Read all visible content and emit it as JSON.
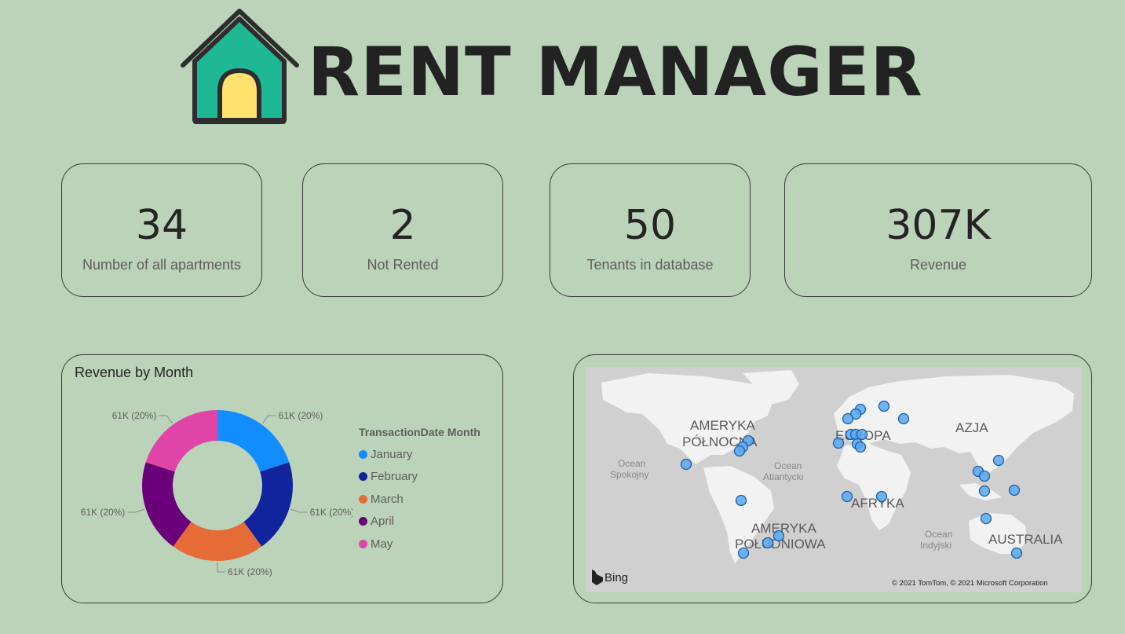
{
  "header": {
    "title": "RENT MANAGER",
    "logo_icon": "house-icon"
  },
  "kpis": [
    {
      "value": "34",
      "label": "Number of all apartments"
    },
    {
      "value": "2",
      "label": "Not Rented"
    },
    {
      "value": "50",
      "label": "Tenants in database"
    },
    {
      "value": "307K",
      "label": "Revenue"
    }
  ],
  "chart_data": {
    "type": "pie",
    "title": "Revenue by Month",
    "legend_title": "TransactionDate Month",
    "legend_position": "right",
    "categories": [
      "January",
      "February",
      "March",
      "April",
      "May"
    ],
    "values": [
      61,
      61,
      61,
      61,
      61
    ],
    "value_unit": "K",
    "percent": [
      20,
      20,
      20,
      20,
      20
    ],
    "data_labels": [
      "61K (20%)",
      "61K (20%)",
      "61K (20%)",
      "61K (20%)",
      "61K (20%)"
    ],
    "colors": [
      "#118dff",
      "#12239e",
      "#e66c37",
      "#6b007b",
      "#e044a7"
    ],
    "donut": true
  },
  "map": {
    "labels": {
      "north_america": [
        "AMERYKA",
        "PÓŁNOCNA"
      ],
      "south_america": [
        "AMERYKA",
        "POŁUDNIOWA"
      ],
      "europe": "EUROPA",
      "asia": "AZJA",
      "africa": "AFRYKA",
      "australia": "AUSTRALIA",
      "pacific": [
        "Ocean",
        "Spokojny"
      ],
      "atlantic": [
        "Ocean",
        "Atlantycki"
      ],
      "indian": [
        "Ocean",
        "Indyjski"
      ]
    },
    "attribution": "© 2021 TomTom, © 2021 Microsoft Corporation",
    "provider": "Bing",
    "marker_color": "#5aa8f0"
  }
}
